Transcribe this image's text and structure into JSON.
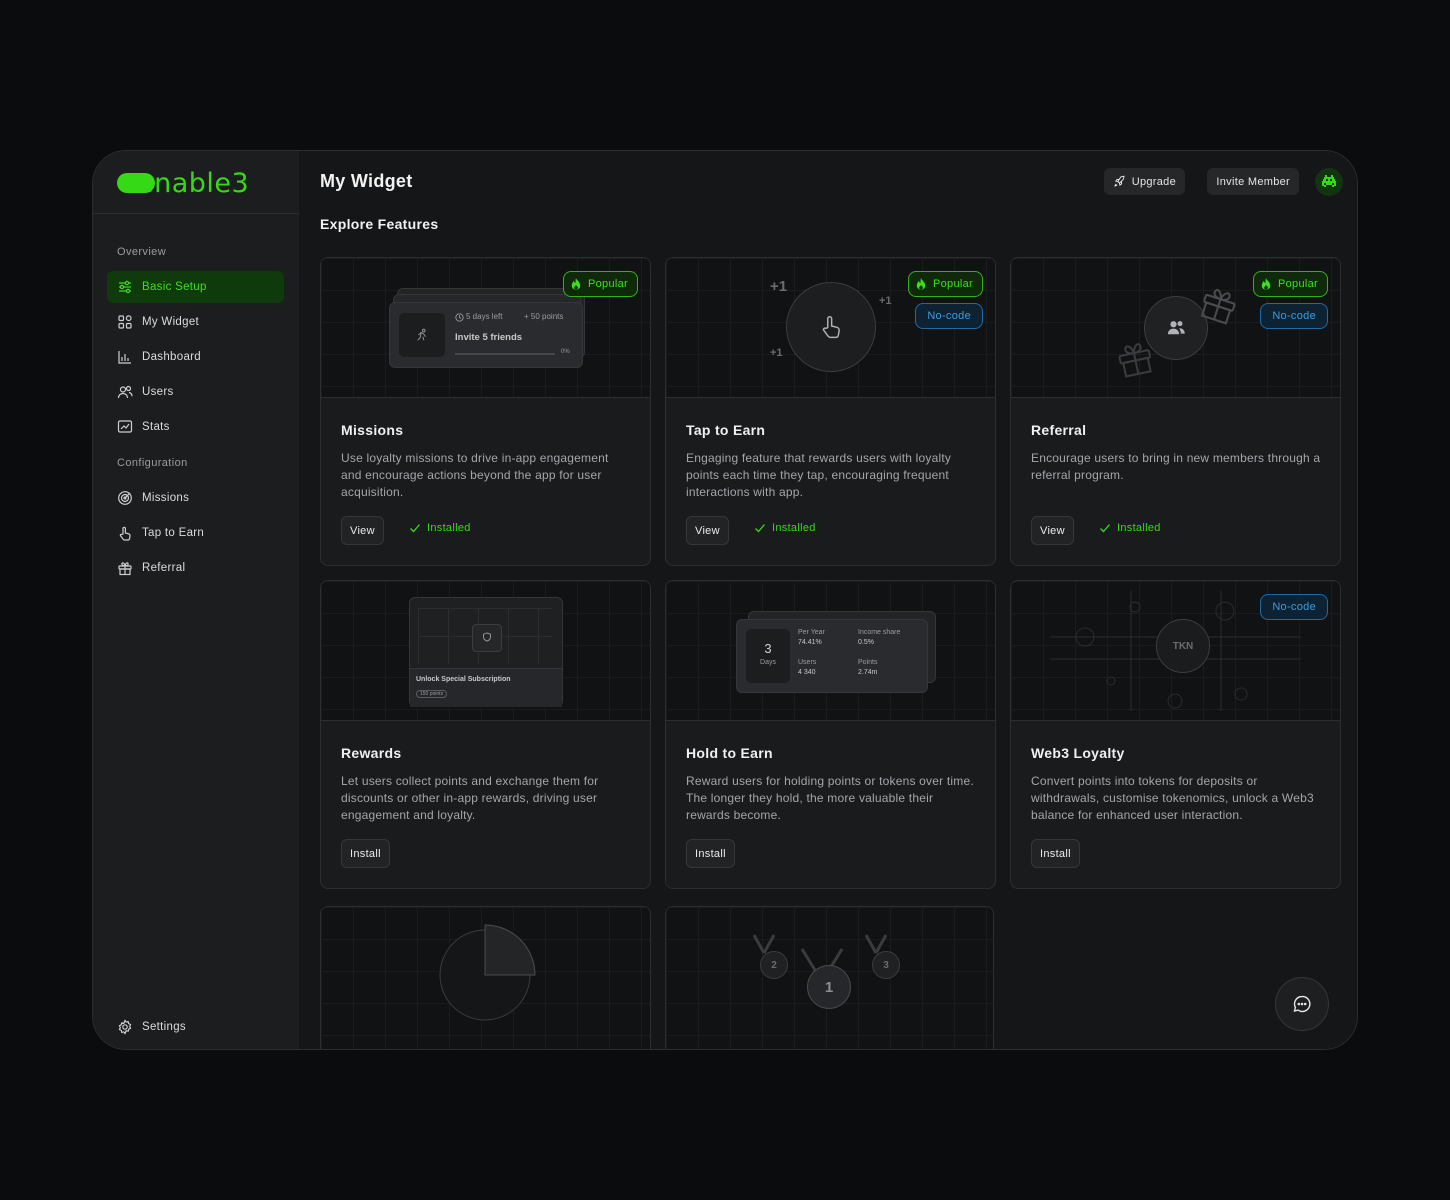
{
  "brand": {
    "name": "enable3",
    "accent": "#36d915",
    "info": "#3d9be0"
  },
  "sidebar": {
    "sections": [
      {
        "label": "Overview"
      },
      {
        "label": "Configuration"
      }
    ],
    "items": [
      {
        "label": "Basic Setup",
        "icon": "sliders-icon",
        "active": true
      },
      {
        "label": "My Widget",
        "icon": "widget-grid-icon"
      },
      {
        "label": "Dashboard",
        "icon": "bar-chart-icon"
      },
      {
        "label": "Users",
        "icon": "users-icon"
      },
      {
        "label": "Stats",
        "icon": "stats-chart-icon"
      },
      {
        "label": "Missions",
        "icon": "target-icon"
      },
      {
        "label": "Tap to Earn",
        "icon": "tap-hand-icon"
      },
      {
        "label": "Referral",
        "icon": "gift-icon"
      }
    ],
    "settings_label": "Settings"
  },
  "header": {
    "title": "My Widget",
    "upgrade_label": "Upgrade",
    "invite_label": "Invite Member"
  },
  "main": {
    "section_title": "Explore Features"
  },
  "cards": [
    {
      "title": "Missions",
      "desc": "Use loyalty missions to drive in-app engagement and encourage actions beyond the app for user acquisition.",
      "button": "View",
      "status": "Installed",
      "badges": [
        "Popular"
      ]
    },
    {
      "title": "Tap to Earn",
      "desc": "Engaging feature that rewards users with loyalty points each time they tap, encouraging frequent interactions with app.",
      "button": "View",
      "status": "Installed",
      "badges": [
        "Popular",
        "No-code"
      ]
    },
    {
      "title": "Referral",
      "desc": "Encourage users to bring in new members through a referral program.",
      "button": "View",
      "status": "Installed",
      "badges": [
        "Popular",
        "No-code"
      ]
    },
    {
      "title": "Rewards",
      "desc": "Let users collect points and exchange them for discounts or other in-app rewards, driving user engagement and loyalty.",
      "button": "Install"
    },
    {
      "title": "Hold to Earn",
      "desc": "Reward users for holding points or tokens over time. The longer they hold, the more valuable their rewards become.",
      "button": "Install"
    },
    {
      "title": "Web3 Loyalty",
      "desc": "Convert points into tokens for deposits or withdrawals, customise tokenomics, unlock a Web3 balance for enhanced user interaction.",
      "button": "Install",
      "badges": [
        "No-code"
      ]
    }
  ],
  "visuals": {
    "missions": {
      "days_left": "5 days left",
      "points": "+ 50 points",
      "task": "Invite 5 friends",
      "progress": "0%"
    },
    "tap": {
      "plus_big": "+1",
      "plus_small": "+1",
      "plus_small2": "+1"
    },
    "rewards": {
      "unlock": "Unlock Special Subscription",
      "cost": "150 points"
    },
    "hold": {
      "days_num": "3",
      "days_label": "Days",
      "per_year_label": "Per Year",
      "per_year_value": "74.41%",
      "income_label": "Income share",
      "income_value": "0.5%",
      "users_label": "Users",
      "users_value": "4 340",
      "points_label": "Points",
      "points_value": "2.74m"
    },
    "web3": {
      "token": "TKN"
    },
    "medals": {
      "first": "1",
      "second": "2",
      "third": "3"
    }
  }
}
